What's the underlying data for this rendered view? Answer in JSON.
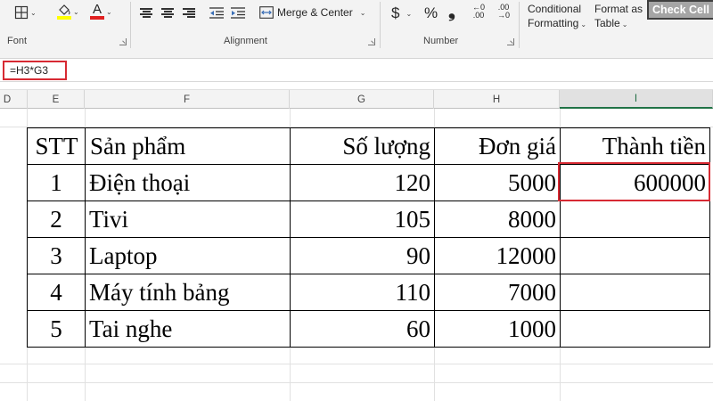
{
  "ribbon": {
    "font_group_label": "Font",
    "alignment_group_label": "Alignment",
    "number_group_label": "Number",
    "merge_center_label": "Merge & Center",
    "currency_symbol": "$",
    "percent_symbol": "%",
    "comma_symbol": "❟",
    "increase_decimal_top": "←0",
    "increase_decimal_bottom": ".00",
    "decrease_decimal_top": ".00",
    "decrease_decimal_bottom": "→0",
    "conditional_formatting_line1": "Conditional",
    "conditional_formatting_line2": "Formatting",
    "format_as_table_line1": "Format as",
    "format_as_table_line2": "Table",
    "check_cell_label": "Check Cell",
    "font_color_letter": "A",
    "colors": {
      "fill": "#ffff00",
      "font": "#e02020",
      "accent": "#217346"
    }
  },
  "formula_bar": {
    "formula": "=H3*G3"
  },
  "columns": [
    "D",
    "E",
    "F",
    "G",
    "H",
    "I"
  ],
  "active_column": "I",
  "table": {
    "headers": [
      "STT",
      "Sản phẩm",
      "Số lượng",
      "Đơn giá",
      "Thành tiền"
    ],
    "rows": [
      [
        "1",
        "Điện thoại",
        "120",
        "5000",
        "600000"
      ],
      [
        "2",
        "Tivi",
        "105",
        "8000",
        ""
      ],
      [
        "3",
        "Laptop",
        "90",
        "12000",
        ""
      ],
      [
        "4",
        "Máy tính bảng",
        "110",
        "7000",
        ""
      ],
      [
        "5",
        "Tai nghe",
        "60",
        "1000",
        ""
      ]
    ]
  }
}
